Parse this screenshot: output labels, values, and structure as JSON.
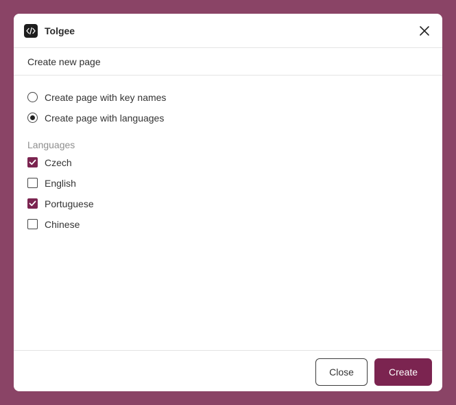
{
  "dialog": {
    "app_name": "Tolgee",
    "subtitle": "Create new page",
    "app_icon": "code-icon",
    "close_icon": "close-icon"
  },
  "mode_options": [
    {
      "label": "Create page with key names",
      "selected": false
    },
    {
      "label": "Create page with languages",
      "selected": true
    }
  ],
  "languages": {
    "heading": "Languages",
    "items": [
      {
        "label": "Czech",
        "checked": true
      },
      {
        "label": "English",
        "checked": false
      },
      {
        "label": "Portuguese",
        "checked": true
      },
      {
        "label": "Chinese",
        "checked": false
      }
    ]
  },
  "footer": {
    "close_label": "Close",
    "create_label": "Create"
  },
  "colors": {
    "accent": "#7b2450",
    "backdrop": "#8a4466"
  }
}
